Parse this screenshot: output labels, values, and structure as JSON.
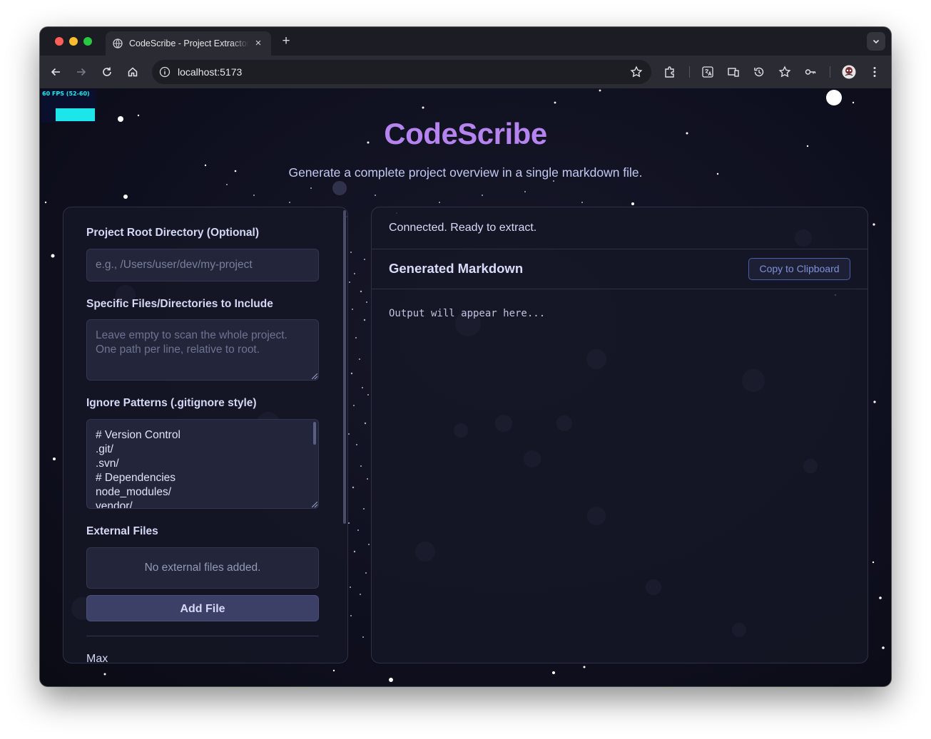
{
  "browser": {
    "tab_title": "CodeScribe - Project Extractor",
    "url": "localhost:5173"
  },
  "fps_meter": {
    "label": "60 FPS (52-60)"
  },
  "app": {
    "title": "CodeScribe",
    "subtitle": "Generate a complete project overview in a single markdown file."
  },
  "config": {
    "root_label": "Project Root Directory (Optional)",
    "root_placeholder": "e.g., /Users/user/dev/my-project",
    "include_label": "Specific Files/Directories to Include",
    "include_placeholder_line1": "Leave empty to scan the whole project.",
    "include_placeholder_line2": "One path per line, relative to root.",
    "ignore_label": "Ignore Patterns (.gitignore style)",
    "ignore_lines": [
      "# Version Control",
      ".git/",
      ".svn/",
      "# Dependencies",
      "node_modules/",
      "vendor/"
    ],
    "external_label": "External Files",
    "external_empty": "No external files added.",
    "add_file_label": "Add File",
    "max_label": "Max"
  },
  "output": {
    "status": "Connected. Ready to extract.",
    "title": "Generated Markdown",
    "copy_label": "Copy to Clipboard",
    "placeholder": "Output will appear here..."
  },
  "colors": {
    "accent": "#b584ee",
    "fps": "#1de6ea",
    "background": "#0d0d17"
  }
}
